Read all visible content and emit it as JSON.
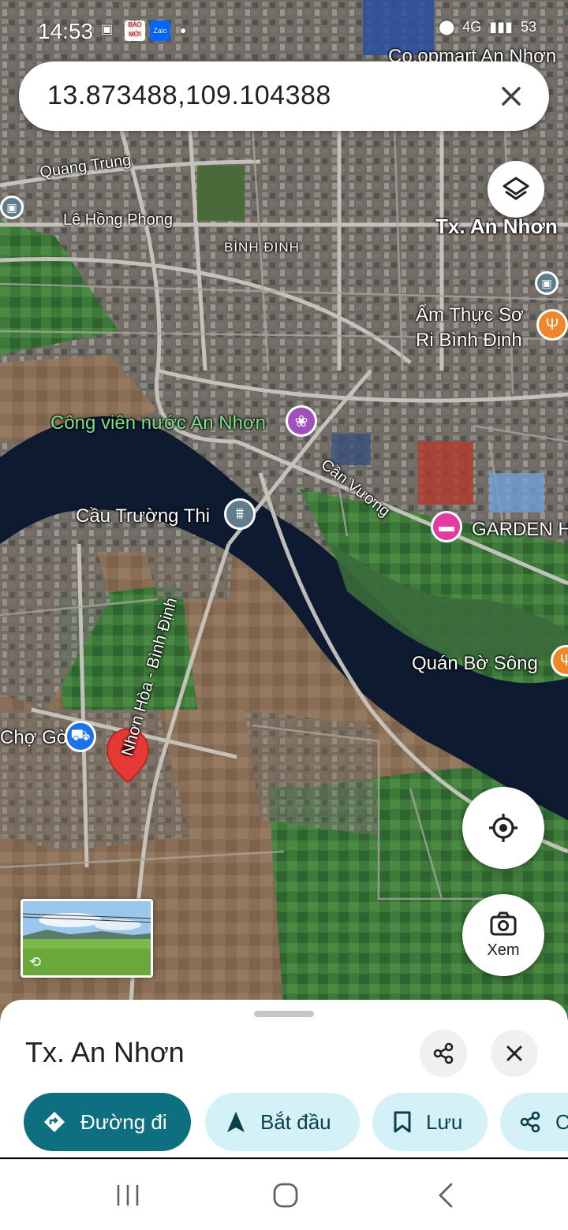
{
  "status_bar": {
    "time": "14:53",
    "app_icons": [
      "BÁO MỚI",
      "Zalo"
    ],
    "network": "4G",
    "battery": "53"
  },
  "search": {
    "query": "13.873488,109.104388",
    "clear_icon": "close-icon"
  },
  "map": {
    "labels": {
      "coopmart": "Co.opmart An Nhơn",
      "quang_trung": "Quang Trung",
      "le_hong_phong": "Lê Hồng Phong",
      "tx_an_nhon": "Tx. An Nhơn",
      "binh_dinh": "BÌNH ĐỊNH",
      "am_thuc_1": "Ẩm Thực Sơ",
      "am_thuc_2": "Ri Bình Định",
      "cong_vien": "Công viên nước An Nhơn",
      "can_vuong": "Cần Vương",
      "cau_truong_thi": "Cầu Trường Thi",
      "garden": "GARDEN H",
      "quan_bo_song": "Quán Bờ Sông",
      "cho_go": "Chợ Gò",
      "nhon_hoa": "Nhơn Hòa - Bình Định"
    },
    "colors": {
      "river": "#0d1a30",
      "farmland": "#8a7058",
      "urban": "#6e6e6a",
      "field_green": "#3e7a3a",
      "pin_red": "#e53935",
      "poi_purple": "#a24fbe",
      "poi_orange": "#f0862a",
      "poi_blue": "#1a73e8",
      "poi_pink": "#e53aa0",
      "poi_gray": "#607d8b"
    }
  },
  "controls": {
    "layers_icon": "layers-icon",
    "locate_icon": "my-location-icon",
    "view_label": "Xem"
  },
  "sheet": {
    "place_title": "Tx. An Nhơn",
    "actions": [
      {
        "label": "Đường đi",
        "icon": "directions-icon"
      },
      {
        "label": "Bắt đầu",
        "icon": "navigation-arrow-icon"
      },
      {
        "label": "Lưu",
        "icon": "bookmark-icon"
      },
      {
        "label": "C",
        "icon": "share-icon"
      }
    ]
  },
  "nav_bar": {
    "recent_icon": "recent-apps-icon",
    "home_icon": "home-icon",
    "back_icon": "back-icon"
  }
}
